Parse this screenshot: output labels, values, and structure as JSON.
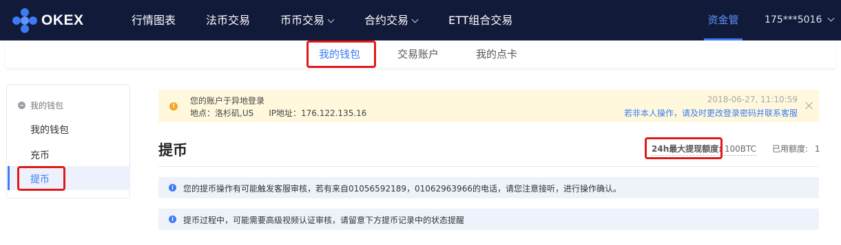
{
  "brand": {
    "name": "OKEX"
  },
  "topnav": {
    "items": [
      {
        "label": "行情图表",
        "has_dropdown": false
      },
      {
        "label": "法币交易",
        "has_dropdown": false
      },
      {
        "label": "币币交易",
        "has_dropdown": true
      },
      {
        "label": "合约交易",
        "has_dropdown": true
      },
      {
        "label": "ETT组合交易",
        "has_dropdown": false
      }
    ],
    "asset_management": "资金管理",
    "user": "175***5016"
  },
  "subtabs": {
    "items": [
      "我的钱包",
      "交易账户",
      "我的点卡"
    ],
    "active": "我的钱包"
  },
  "sidebar": {
    "header": "我的钱包",
    "items": [
      "我的钱包",
      "充币",
      "提币"
    ],
    "active": "提币"
  },
  "notice": {
    "title": "您的账户于异地登录",
    "location": "地点：洛杉矶,US",
    "ip": "IP地址：176.122.135.16",
    "datetime": "2018-06-27, 11:10:59",
    "link": "若非本人操作，请及时更改登录密码并联系客服"
  },
  "withdraw": {
    "title": "提币",
    "limit_label": "24h最大提现额度:",
    "limit_value": "100BTC",
    "used_label": "已用额度:",
    "used_value": "1"
  },
  "info_messages": [
    "您的提币操作有可能触发客服审核，若有来自01056592189，01062963966的电话，请您注意接听，进行操作确认。",
    "提币过程中，可能需要高级视频认证审核，请留意下方提币记录中的状态提醒"
  ],
  "colors": {
    "nav_bg": "#121a3a",
    "accent": "#3b7bf5",
    "highlight": "#e01818",
    "notice_bg": "#fff8dc",
    "info_bg": "#eef2fb"
  }
}
